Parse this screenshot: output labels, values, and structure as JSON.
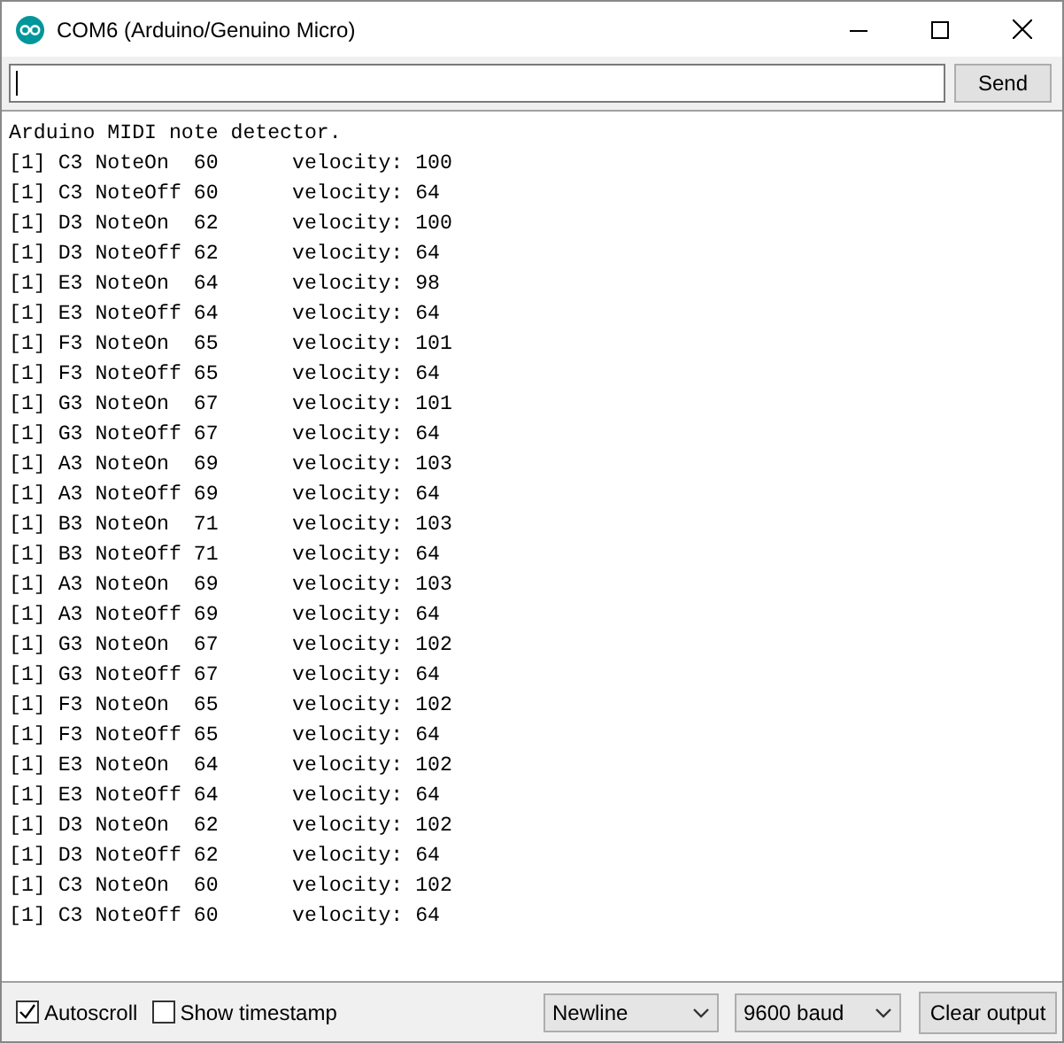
{
  "window": {
    "title": "COM6 (Arduino/Genuino Micro)"
  },
  "send_button": "Send",
  "output_lines": [
    "Arduino MIDI note detector.",
    "[1] C3 NoteOn  60      velocity: 100",
    "[1] C3 NoteOff 60      velocity: 64",
    "[1] D3 NoteOn  62      velocity: 100",
    "[1] D3 NoteOff 62      velocity: 64",
    "[1] E3 NoteOn  64      velocity: 98",
    "[1] E3 NoteOff 64      velocity: 64",
    "[1] F3 NoteOn  65      velocity: 101",
    "[1] F3 NoteOff 65      velocity: 64",
    "[1] G3 NoteOn  67      velocity: 101",
    "[1] G3 NoteOff 67      velocity: 64",
    "[1] A3 NoteOn  69      velocity: 103",
    "[1] A3 NoteOff 69      velocity: 64",
    "[1] B3 NoteOn  71      velocity: 103",
    "[1] B3 NoteOff 71      velocity: 64",
    "[1] A3 NoteOn  69      velocity: 103",
    "[1] A3 NoteOff 69      velocity: 64",
    "[1] G3 NoteOn  67      velocity: 102",
    "[1] G3 NoteOff 67      velocity: 64",
    "[1] F3 NoteOn  65      velocity: 102",
    "[1] F3 NoteOff 65      velocity: 64",
    "[1] E3 NoteOn  64      velocity: 102",
    "[1] E3 NoteOff 64      velocity: 64",
    "[1] D3 NoteOn  62      velocity: 102",
    "[1] D3 NoteOff 62      velocity: 64",
    "[1] C3 NoteOn  60      velocity: 102",
    "[1] C3 NoteOff 60      velocity: 64"
  ],
  "checkboxes": [
    {
      "label": "Autoscroll",
      "checked": true
    },
    {
      "label": "Show timestamp",
      "checked": false
    }
  ],
  "line_ending": {
    "value": "Newline"
  },
  "baud_rate": {
    "value": "9600 baud"
  },
  "clear_button": "Clear output"
}
